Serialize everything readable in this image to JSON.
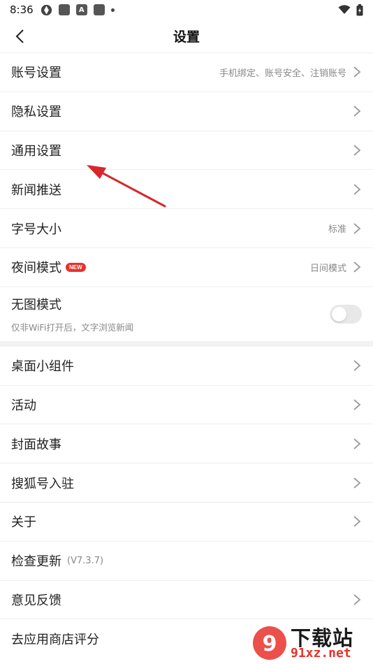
{
  "status_bar": {
    "time": "8:36",
    "icon_a": "A"
  },
  "header": {
    "title": "设置"
  },
  "group1": [
    {
      "label": "账号设置",
      "value": "手机绑定、账号安全、注销账号"
    },
    {
      "label": "隐私设置",
      "value": ""
    },
    {
      "label": "通用设置",
      "value": ""
    },
    {
      "label": "新闻推送",
      "value": ""
    },
    {
      "label": "字号大小",
      "value": "标准"
    },
    {
      "label": "夜间模式",
      "badge": "NEW",
      "value": "日间模式"
    }
  ],
  "no_image_mode": {
    "label": "无图模式",
    "sub": "仅非WiFi打开后，文字浏览新闻",
    "enabled": false
  },
  "group2": [
    {
      "label": "桌面小组件"
    },
    {
      "label": "活动"
    },
    {
      "label": "封面故事"
    },
    {
      "label": "搜狐号入驻"
    },
    {
      "label": "关于"
    }
  ],
  "check_update": {
    "label": "检查更新",
    "version": "(V7.3.7)"
  },
  "feedback": {
    "label": "意见反馈"
  },
  "rate_app": {
    "label": "去应用商店评分"
  },
  "watermark": {
    "title": "下载站",
    "url": "91xz.net",
    "icon_text": "9"
  },
  "colors": {
    "accent": "#e8312b",
    "annotation_arrow": "#d9262b"
  }
}
